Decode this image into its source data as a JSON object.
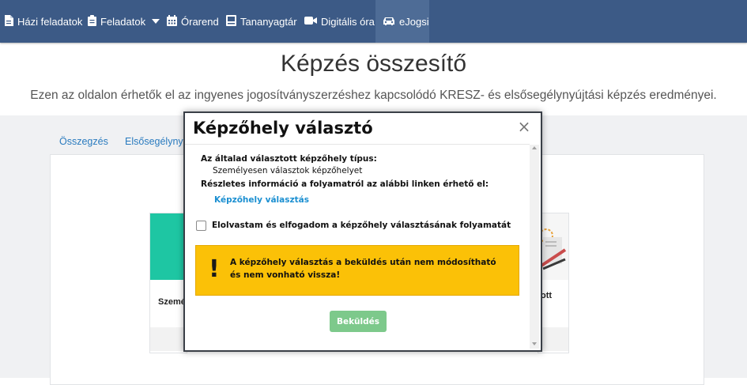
{
  "navbar": {
    "items": [
      {
        "label": "Házi feladatok",
        "icon": "document-icon"
      },
      {
        "label": "Feladatok",
        "icon": "clipboard-icon"
      },
      {
        "label": "Órarend",
        "icon": "calendar-icon"
      },
      {
        "label": "Tananyagtár",
        "icon": "book-icon"
      },
      {
        "label": "Digitális óra",
        "icon": "video-camera-icon"
      },
      {
        "label": "eJogsi",
        "icon": "car-icon"
      }
    ],
    "active": "eJogsi"
  },
  "header": {
    "title": "Képzés összesítő",
    "subtitle": "Ezen az oldalon érhetők el az ingyenes jogosítványszerzéshez kapcsolódó KRESZ- és elsősegélynyújtási képzés eredményei."
  },
  "tabs": [
    "Összegzés",
    "Elsősegélynyú"
  ],
  "cards": {
    "left_label": "Szemé",
    "right_label": "ott"
  },
  "modal": {
    "title": "Képzőhely választó",
    "type_label": "Az általad választott képzőhely típus:",
    "type_value": "Személyesen választok képzőhelyet",
    "info_label": "Részletes információ a folyamatról az alábbi linken érhető el:",
    "link_text": "Képzőhely választás",
    "checkbox_label": "Elolvastam és elfogadom a képzőhely választásának folyamatát",
    "checkbox_checked": false,
    "warning_icon": "!",
    "warning_text": "A képzőhely választás a beküldés után nem módosítható és nem vonható vissza!",
    "submit_label": "Beküldés"
  },
  "colors": {
    "navbar": "#3c5a86",
    "accent_link": "#1b8fd1",
    "warning": "#fbc107",
    "submit": "#7dc98b",
    "teal": "#1ec6a3"
  }
}
